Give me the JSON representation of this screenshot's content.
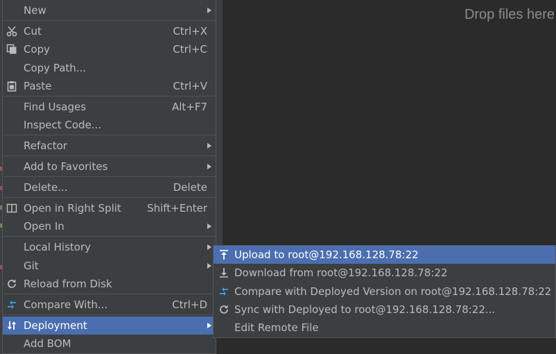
{
  "editor": {
    "drop_hint": "Drop files here"
  },
  "context_menu": {
    "items": [
      {
        "label": "New",
        "shortcut": ""
      },
      {
        "label": "Cut",
        "shortcut": "Ctrl+X",
        "icon": "scissors-icon"
      },
      {
        "label": "Copy",
        "shortcut": "Ctrl+C",
        "icon": "copy-icon"
      },
      {
        "label": "Copy Path...",
        "shortcut": ""
      },
      {
        "label": "Paste",
        "shortcut": "Ctrl+V",
        "icon": "clipboard-icon"
      },
      {
        "label": "Find Usages",
        "shortcut": "Alt+F7"
      },
      {
        "label": "Inspect Code...",
        "shortcut": ""
      },
      {
        "label": "Refactor",
        "shortcut": ""
      },
      {
        "label": "Add to Favorites",
        "shortcut": ""
      },
      {
        "label": "Delete...",
        "shortcut": "Delete"
      },
      {
        "label": "Open in Right Split",
        "shortcut": "Shift+Enter",
        "icon": "split-view-icon"
      },
      {
        "label": "Open In",
        "shortcut": ""
      },
      {
        "label": "Local History",
        "shortcut": ""
      },
      {
        "label": "Git",
        "shortcut": ""
      },
      {
        "label": "Reload from Disk",
        "shortcut": "",
        "icon": "reload-icon"
      },
      {
        "label": "Compare With...",
        "shortcut": "Ctrl+D",
        "icon": "compare-icon"
      },
      {
        "label": "Deployment",
        "shortcut": "",
        "icon": "deployment-icon",
        "selected": true
      },
      {
        "label": "Add BOM",
        "shortcut": ""
      }
    ]
  },
  "deployment_submenu": {
    "items": [
      {
        "label": "Upload to root@192.168.128.78:22",
        "icon": "upload-icon",
        "selected": true
      },
      {
        "label": "Download from root@192.168.128.78:22",
        "icon": "download-icon"
      },
      {
        "label": "Compare with Deployed Version on root@192.168.128.78:22",
        "icon": "compare-icon"
      },
      {
        "label": "Sync with Deployed to root@192.168.128.78:22...",
        "icon": "sync-icon"
      },
      {
        "label": "Edit Remote File",
        "icon": ""
      }
    ]
  },
  "colors": {
    "background": "#2b2b2b",
    "menu_background": "#3c3f41",
    "selection": "#4b6eaf",
    "text": "#bbbbbb",
    "accent_blue": "#3d9ee9"
  }
}
